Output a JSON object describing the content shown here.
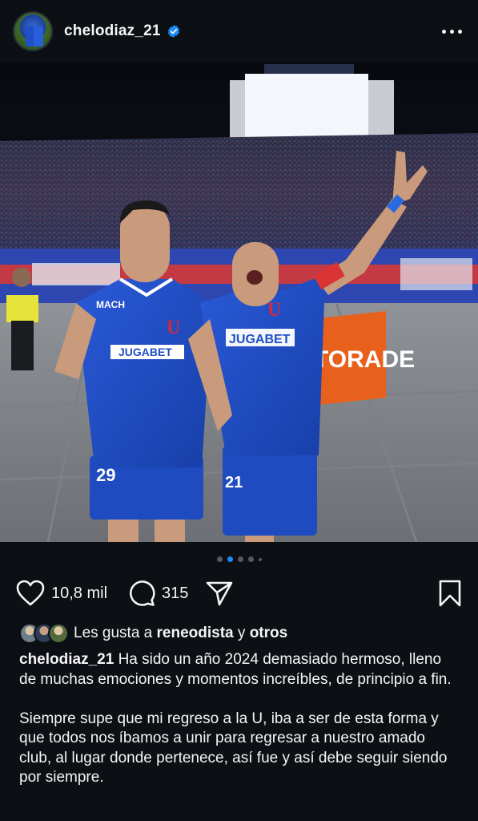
{
  "post": {
    "username": "chelodiaz_21",
    "verified": true,
    "more_label": "More options"
  },
  "carousel": {
    "count": 5,
    "active_index": 1
  },
  "actions": {
    "likes": "10,8 mil",
    "comments": "315"
  },
  "liked_by": {
    "prefix": "Les gusta a",
    "user": "reneodista",
    "connector": "y",
    "others": "otros"
  },
  "caption": {
    "username": "chelodiaz_21",
    "paragraph_1": "Ha sido un año 2024 demasiado hermoso, lleno de muchas emociones y momentos increíbles, de principio a fin.",
    "paragraph_2": "Siempre supe que mi regreso a la U, iba a ser de esta forma y que todos nos íbamos a unir para regresar a nuestro amado club, al lugar donde pertenece, así fue y así debe seguir siendo por siempre."
  },
  "photo": {
    "banner_text": "TORADE",
    "jersey_sponsor": "JUGABET",
    "jersey_brand_left": "MACH",
    "jersey_number_left": "29",
    "jersey_number_right": "21",
    "club_letter": "U"
  },
  "colors": {
    "background": "#0c0f14",
    "text": "#f5f5f5",
    "accent_blue": "#1d8cf8",
    "jersey_blue": "#1f4fc6",
    "banner_orange": "#e8611c"
  },
  "icons": {
    "like": "heart-icon",
    "comment": "comment-icon",
    "share": "paper-plane-icon",
    "save": "bookmark-icon",
    "verified": "verified-badge-icon",
    "more": "more-dots-icon"
  }
}
